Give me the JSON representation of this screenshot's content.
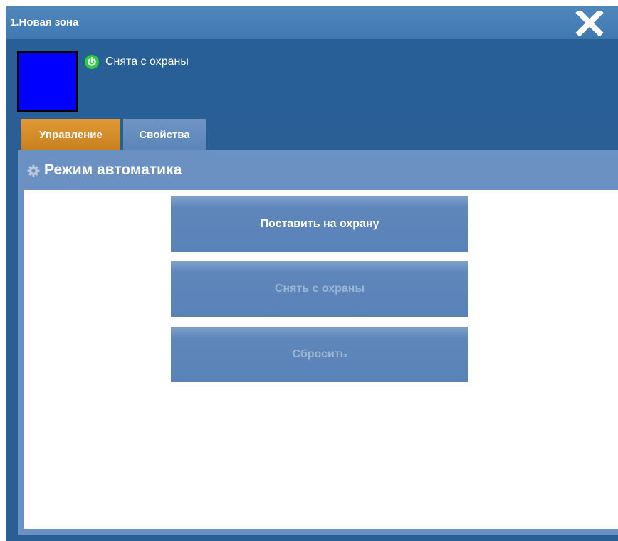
{
  "window": {
    "title": "1.Новая зона",
    "close_icon": "close-icon"
  },
  "header": {
    "swatch_color": "#0000ff",
    "status_icon": "power-icon",
    "status_icon_color": "#2ecc40",
    "status_text": "Снята с охраны"
  },
  "tabs": [
    {
      "label": "Управление",
      "active": true
    },
    {
      "label": "Свойства",
      "active": false
    }
  ],
  "section": {
    "icon": "gear-icon",
    "title": "Режим автоматика"
  },
  "actions": [
    {
      "label": "Поставить на охрану",
      "enabled": true
    },
    {
      "label": "Снять с охраны",
      "enabled": false
    },
    {
      "label": "Сбросить",
      "enabled": false
    }
  ],
  "colors": {
    "titlebar": "#4a83ba",
    "window_bg": "#2a5f96",
    "active_tab": "#d98d28",
    "panel": "#6a91c1",
    "button": "#5e86bb"
  }
}
